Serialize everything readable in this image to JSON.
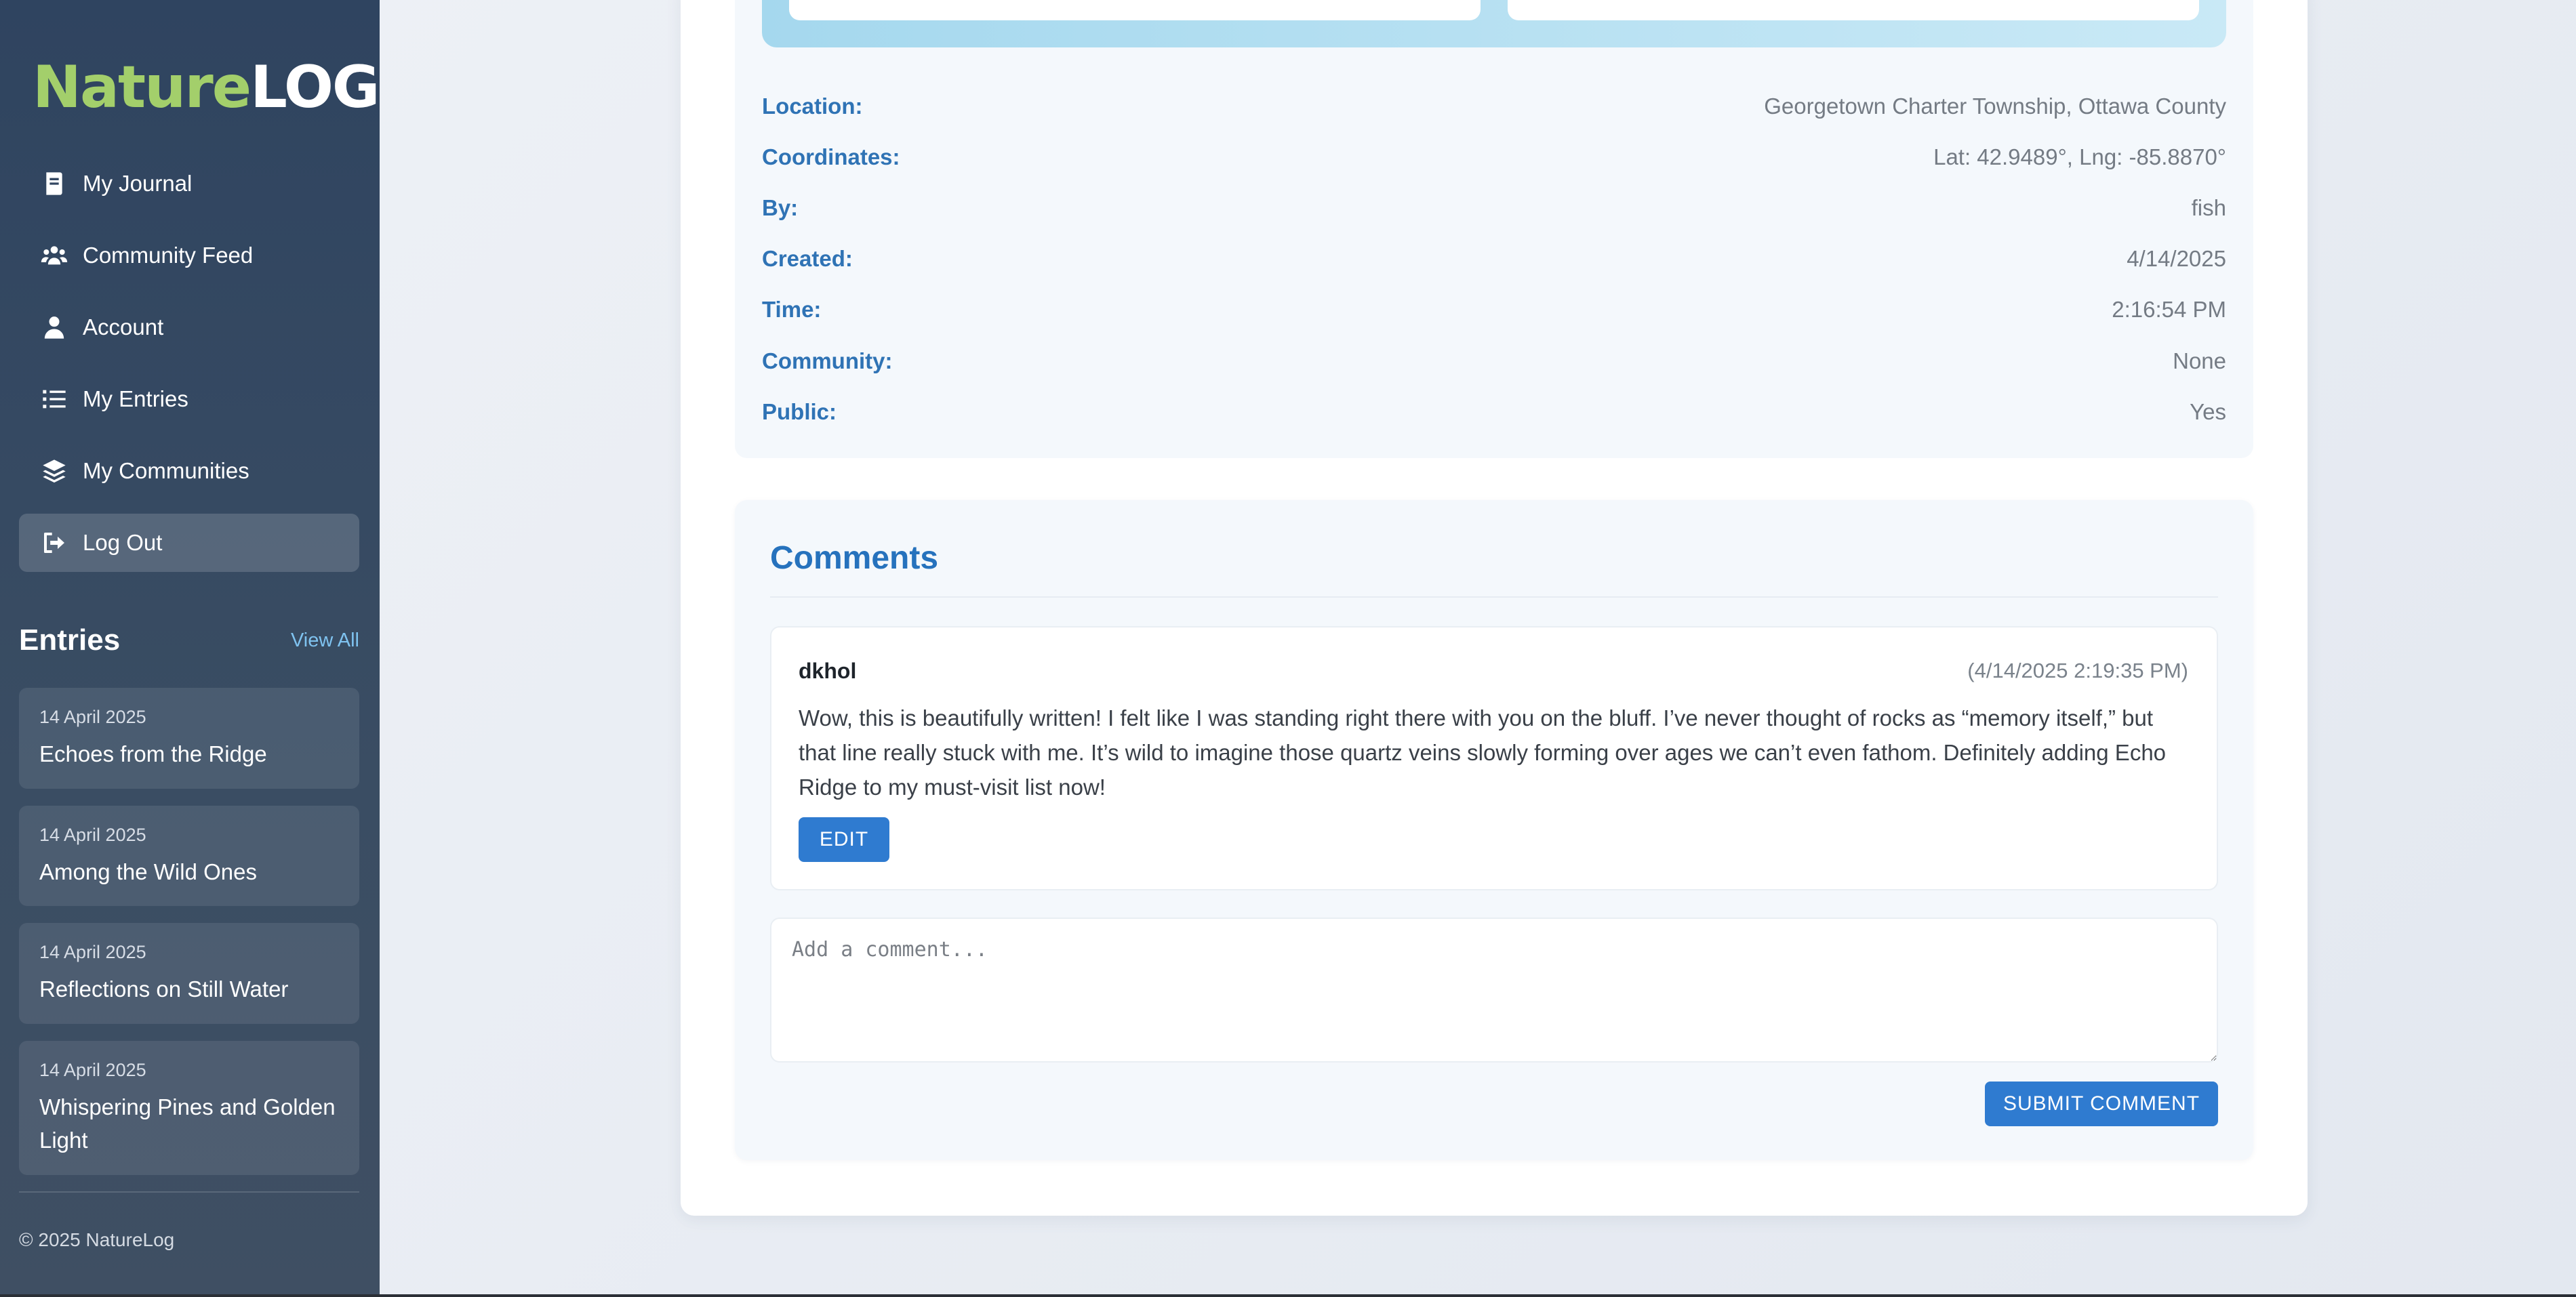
{
  "sidebar": {
    "logo": {
      "nature": "Nature",
      "log": "LOG"
    },
    "nav": [
      {
        "label": "My Journal",
        "icon": "journal-icon"
      },
      {
        "label": "Community Feed",
        "icon": "users-icon"
      },
      {
        "label": "Account",
        "icon": "user-icon"
      },
      {
        "label": "My Entries",
        "icon": "list-icon"
      },
      {
        "label": "My Communities",
        "icon": "layers-icon"
      },
      {
        "label": "Log Out",
        "icon": "logout-icon"
      }
    ],
    "entries_title": "Entries",
    "view_all": "View All",
    "entries": [
      {
        "date": "14 April 2025",
        "title": "Echoes from the Ridge"
      },
      {
        "date": "14 April 2025",
        "title": "Among the Wild Ones"
      },
      {
        "date": "14 April 2025",
        "title": "Reflections on Still Water"
      },
      {
        "date": "14 April 2025",
        "title": "Whispering Pines and Golden Light"
      }
    ],
    "copyright": "© 2025 NatureLog"
  },
  "details": {
    "location": {
      "label": "Location:",
      "value": "Georgetown Charter Township, Ottawa County"
    },
    "coordinates": {
      "label": "Coordinates:",
      "value": "Lat: 42.9489°, Lng: -85.8870°"
    },
    "by": {
      "label": "By:",
      "value": "fish"
    },
    "created": {
      "label": "Created:",
      "value": "4/14/2025"
    },
    "time": {
      "label": "Time:",
      "value": "2:16:54 PM"
    },
    "community": {
      "label": "Community:",
      "value": "None"
    },
    "public": {
      "label": "Public:",
      "value": "Yes"
    }
  },
  "comments": {
    "title": "Comments",
    "items": [
      {
        "author": "dkhol",
        "timestamp": "(4/14/2025 2:19:35 PM)",
        "body": "Wow, this is beautifully written! I felt like I was standing right there with you on the bluff. I’ve never thought of rocks as “memory itself,” but that line really stuck with me. It’s wild to imagine those quartz veins slowly forming over ages we can’t even fathom. Definitely adding Echo Ridge to my must-visit list now!",
        "edit_label": "EDIT"
      }
    ],
    "input_placeholder": "Add a comment...",
    "input_value": "",
    "submit_label": "SUBMIT COMMENT"
  },
  "colors": {
    "accent": "#2f7bd0",
    "label_blue": "#2f73b5",
    "logo_green": "#a3cf6b",
    "sidebar_bg": "#2f4460"
  }
}
